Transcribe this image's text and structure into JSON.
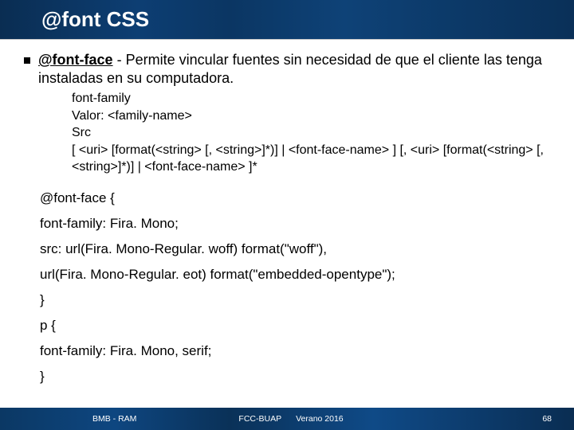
{
  "header": {
    "title": "@font CSS"
  },
  "bullet": {
    "term": "@font-face",
    "sep": " - ",
    "desc": "Permite vincular fuentes sin necesidad de que el cliente las tenga instaladas en su computadora."
  },
  "syntax": {
    "l1": "font-family",
    "l2": "Valor: <family-name>",
    "l3": "Src",
    "l4": "[ <uri> [format(<string> [, <string>]*)] | <font-face-name> ] [, <uri> [format(<string> [, <string>]*)] | <font-face-name> ]*"
  },
  "example": {
    "l1": "@font-face {",
    "l2": "font-family: Fira. Mono;",
    "l3": "src: url(Fira. Mono-Regular. woff) format(\"woff\"),",
    "l4": "url(Fira. Mono-Regular. eot) format(\"embedded-opentype\");",
    "l5": "}",
    "l6": "p {",
    "l7": "font-family: Fira. Mono, serif;",
    "l8": "}"
  },
  "footer": {
    "left": "BMB - RAM",
    "mid1": "FCC-BUAP",
    "mid2": "Verano 2016",
    "right": "68"
  }
}
